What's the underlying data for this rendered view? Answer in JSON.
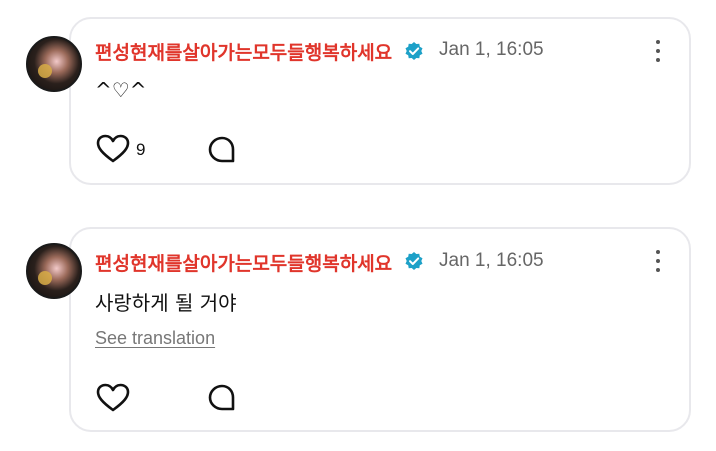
{
  "comments": [
    {
      "username": "편성현재를살아가는모두들행복하세요",
      "timestamp": "Jan 1, 16:05",
      "text": "^♡^",
      "like_count": "9",
      "translate_label": ""
    },
    {
      "username": "편성현재를살아가는모두들행복하세요",
      "timestamp": "Jan 1, 16:05",
      "text": "사랑하게 될 거야",
      "like_count": "",
      "translate_label": "See translation"
    }
  ],
  "colors": {
    "username": "#e0352b",
    "verified_badge": "#1da1c8",
    "card_border": "#e8e8ec"
  },
  "icons": {
    "verified": "verified-badge-icon",
    "more": "more-vertical-icon",
    "like": "heart-outline-icon",
    "reply": "speech-bubble-icon"
  }
}
